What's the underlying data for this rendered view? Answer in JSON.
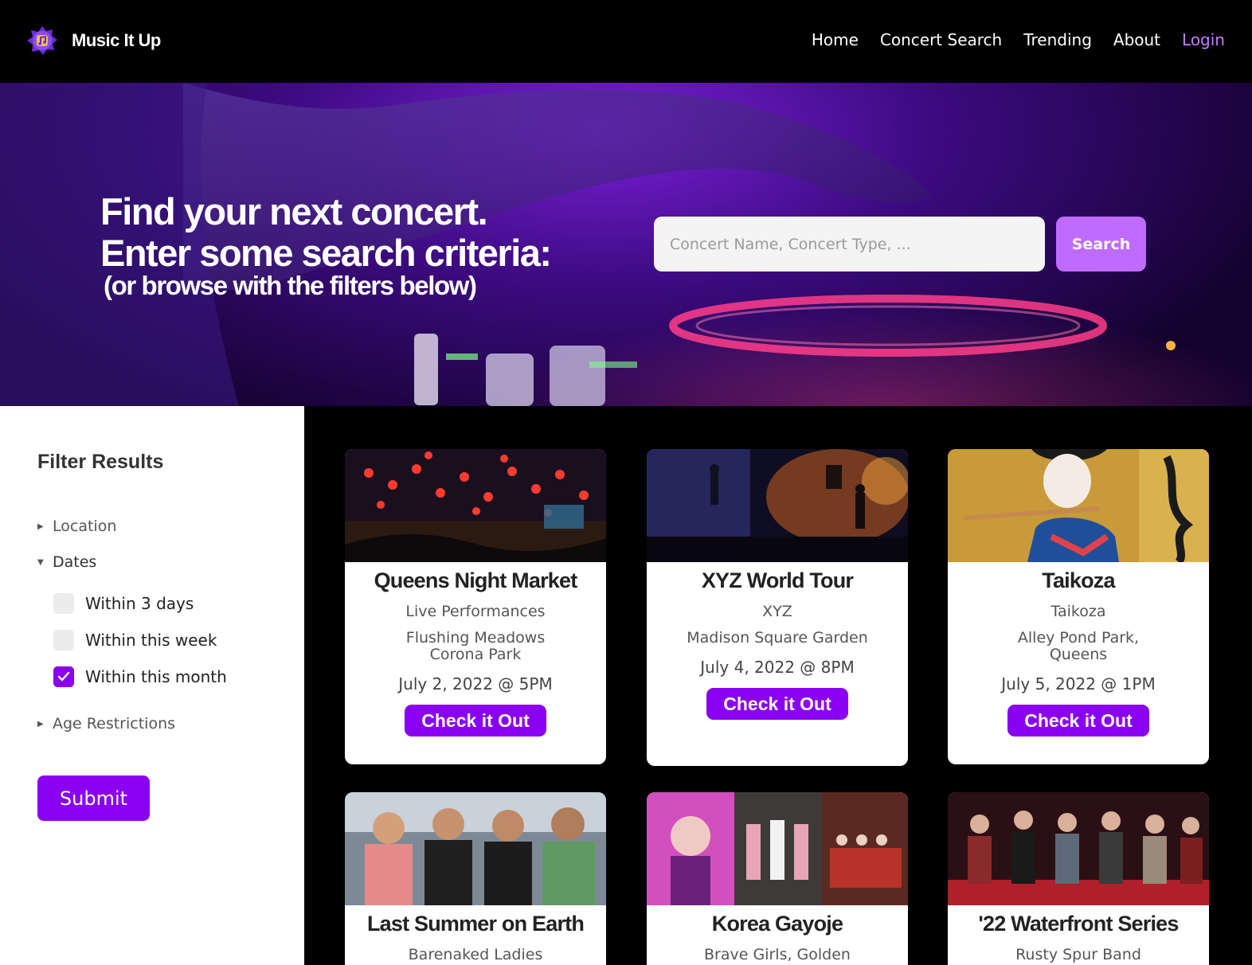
{
  "app": {
    "name": "Music It Up"
  },
  "nav": {
    "items": [
      "Home",
      "Concert Search",
      "Trending",
      "About"
    ],
    "login": "Login"
  },
  "hero": {
    "title_line1": "Find your next concert.",
    "title_line2": "Enter some search criteria:",
    "subtitle": "(or browse with the filters below)",
    "search_placeholder": "Concert Name, Concert Type, ...",
    "search_button": "Search"
  },
  "filters": {
    "title": "Filter Results",
    "location": "Location",
    "dates": "Dates",
    "date_options": [
      {
        "label": "Within 3 days",
        "checked": false
      },
      {
        "label": "Within this week",
        "checked": false
      },
      {
        "label": "Within this month",
        "checked": true
      }
    ],
    "age": "Age Restrictions",
    "submit": "Submit"
  },
  "cards": [
    {
      "title": "Queens Night Market",
      "type": "Live Performances",
      "venue": "Flushing Meadows Corona Park",
      "date": "July 2, 2022 @ 5PM",
      "button": "Check it Out"
    },
    {
      "title": "XYZ World Tour",
      "type": "XYZ",
      "venue": "Madison Square Garden",
      "date": "July 4, 2022 @ 8PM",
      "button": "Check it Out"
    },
    {
      "title": "Taikoza",
      "type": "Taikoza",
      "venue": "Alley Pond Park, Queens",
      "date": "July 5, 2022 @ 1PM",
      "button": "Check it Out"
    },
    {
      "title": "Last Summer on Earth",
      "type": "Barenaked Ladies"
    },
    {
      "title": "Korea Gayoje",
      "type": "Brave Girls, Golden"
    },
    {
      "title": "'22 Waterfront Series",
      "type": "Rusty Spur Band"
    }
  ],
  "colors": {
    "accent": "#8a00f0",
    "search_button": "#c06bff",
    "login": "#c77dff"
  }
}
